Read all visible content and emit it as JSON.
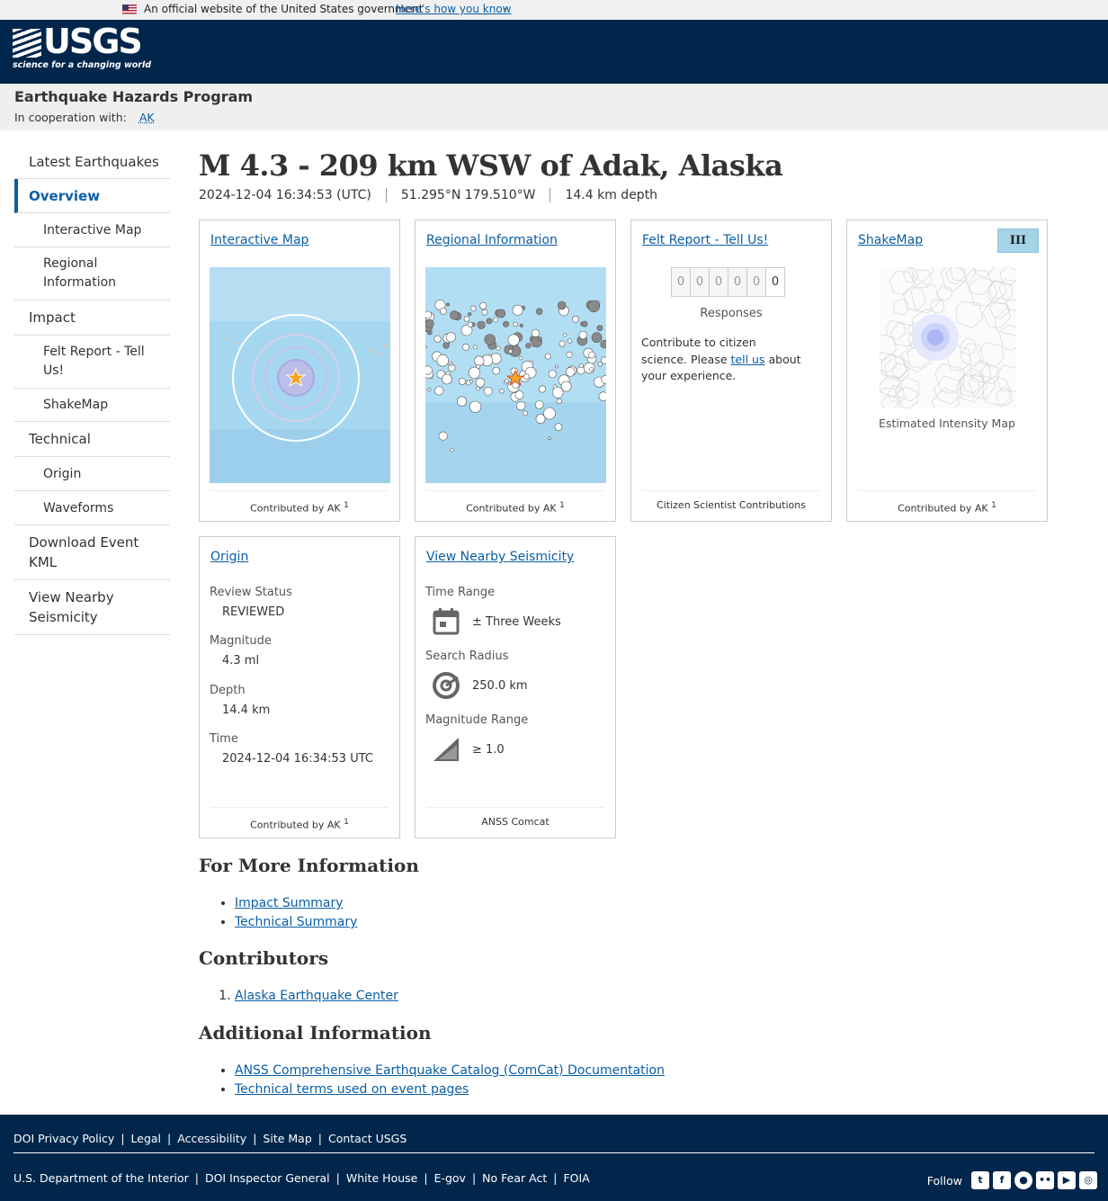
{
  "gov_banner": {
    "text": "An official website of the United States government",
    "link": "Here’s how you know"
  },
  "header": {
    "logo_text": "USGS",
    "tagline": "science for a changing world"
  },
  "program": {
    "name": "Earthquake Hazards Program",
    "coop_label": "In cooperation with:",
    "coop_link": "AK"
  },
  "sidebar": {
    "items": [
      {
        "label": "Latest Earthquakes",
        "level": 0,
        "active": false
      },
      {
        "label": "Overview",
        "level": 0,
        "active": true
      },
      {
        "label": "Interactive Map",
        "level": 1,
        "active": false
      },
      {
        "label": "Regional Information",
        "level": 1,
        "active": false
      },
      {
        "label": "Impact",
        "level": 0,
        "active": false
      },
      {
        "label": "Felt Report - Tell Us!",
        "level": 1,
        "active": false
      },
      {
        "label": "ShakeMap",
        "level": 1,
        "active": false
      },
      {
        "label": "Technical",
        "level": 0,
        "active": false
      },
      {
        "label": "Origin",
        "level": 1,
        "active": false
      },
      {
        "label": "Waveforms",
        "level": 1,
        "active": false
      },
      {
        "label": "Download Event KML",
        "level": 0,
        "active": false
      },
      {
        "label": "View Nearby Seismicity",
        "level": 0,
        "active": false
      }
    ]
  },
  "event": {
    "title": "M 4.3 - 209 km WSW of Adak, Alaska",
    "time": "2024-12-04 16:34:53 (UTC)",
    "coords": "51.295°N 179.510°W",
    "depth": "14.4 km depth"
  },
  "cards": {
    "interactive_map": {
      "title": "Interactive Map",
      "foot": "Contributed by",
      "contrib": "AK",
      "sup": "1"
    },
    "regional": {
      "title": "Regional Information",
      "foot": "Contributed by",
      "contrib": "AK",
      "sup": "1"
    },
    "felt": {
      "title": "Felt Report - Tell Us!",
      "digits": [
        "0",
        "0",
        "0",
        "0",
        "0",
        "0"
      ],
      "responses": "Responses",
      "text1": "Contribute to citizen science. Please",
      "link": "tell us",
      "text2": "about your experience.",
      "foot": "Citizen Scientist Contributions"
    },
    "shakemap": {
      "title": "ShakeMap",
      "intensity": "III",
      "caption": "Estimated Intensity Map",
      "foot": "Contributed by",
      "contrib": "AK",
      "sup": "1"
    },
    "origin": {
      "title": "Origin",
      "fields": [
        {
          "label": "Review Status",
          "value": "REVIEWED"
        },
        {
          "label": "Magnitude",
          "value": "4.3 ml"
        },
        {
          "label": "Depth",
          "value": "14.4 km"
        },
        {
          "label": "Time",
          "value": "2024-12-04 16:34:53 UTC"
        }
      ],
      "foot": "Contributed by",
      "contrib": "AK",
      "sup": "1"
    },
    "nearby": {
      "title": "View Nearby Seismicity",
      "fields": [
        {
          "label": "Time Range",
          "value": "± Three Weeks",
          "icon": "calendar-icon"
        },
        {
          "label": "Search Radius",
          "value": "250.0 km",
          "icon": "radius-target-icon"
        },
        {
          "label": "Magnitude Range",
          "value": "≥ 1.0",
          "icon": "magnitude-wedge-icon"
        }
      ],
      "foot": "ANSS Comcat"
    }
  },
  "more_info": {
    "heading": "For More Information",
    "links": [
      "Impact Summary",
      "Technical Summary"
    ]
  },
  "contributors": {
    "heading": "Contributors",
    "items": [
      "Alaska Earthquake Center"
    ]
  },
  "additional": {
    "heading": "Additional Information",
    "links": [
      "ANSS Comprehensive Earthquake Catalog (ComCat) Documentation",
      "Technical terms used on event pages"
    ]
  },
  "footer": {
    "row1": [
      "DOI Privacy Policy",
      "Legal",
      "Accessibility",
      "Site Map",
      "Contact USGS"
    ],
    "row2": [
      "U.S. Department of the Interior",
      "DOI Inspector General",
      "White House",
      "E-gov",
      "No Fear Act",
      "FOIA"
    ],
    "follow": "Follow",
    "social": [
      "twitter-icon",
      "facebook-icon",
      "github-icon",
      "flickr-icon",
      "youtube-icon",
      "instagram-icon"
    ]
  },
  "colors": {
    "navy": "#00264c",
    "link": "#0b5ea6",
    "map_water": "#a6d7f0",
    "intensity_III": "#a5d4e8"
  }
}
